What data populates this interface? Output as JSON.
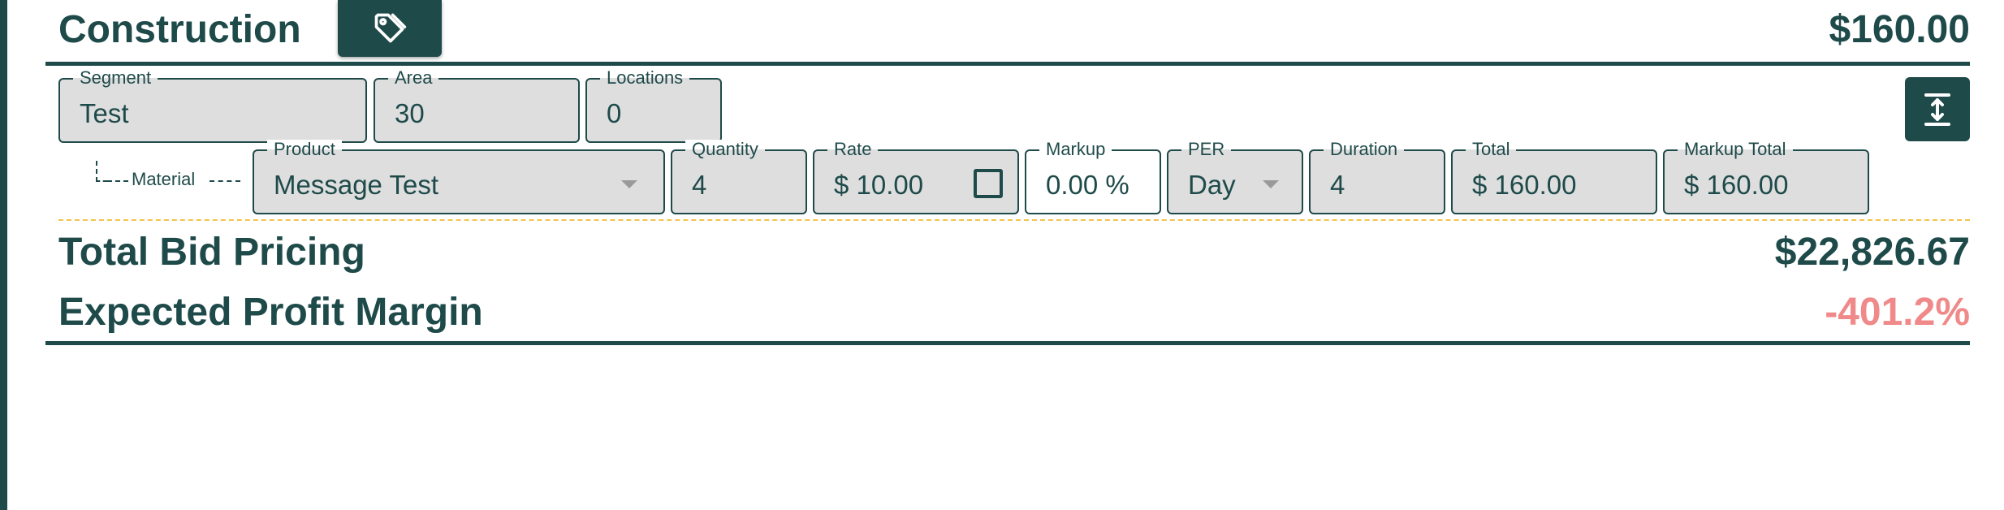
{
  "header": {
    "title": "Construction",
    "total": "$160.00",
    "tag_icon": "tag-icon"
  },
  "segment_fields": [
    {
      "label": "Segment",
      "value": "Test"
    },
    {
      "label": "Area",
      "value": "30"
    },
    {
      "label": "Locations",
      "value": "0"
    }
  ],
  "expand_icon": "expand-vertical-icon",
  "line_item": {
    "type_label": "Material",
    "product": {
      "label": "Product",
      "value": "Message Test"
    },
    "quantity": {
      "label": "Quantity",
      "value": "4"
    },
    "rate": {
      "label": "Rate",
      "value": "$ 10.00",
      "checkbox_checked": false
    },
    "markup": {
      "label": "Markup",
      "value": "0.00 %"
    },
    "per": {
      "label": "PER",
      "value": "Day"
    },
    "duration": {
      "label": "Duration",
      "value": "4"
    },
    "total": {
      "label": "Total",
      "value": "$ 160.00"
    },
    "markup_total": {
      "label": "Markup Total",
      "value": "$ 160.00"
    }
  },
  "summary": {
    "total_bid_label": "Total Bid Pricing",
    "total_bid_value": "$22,826.67",
    "profit_margin_label": "Expected Profit Margin",
    "profit_margin_value": "-401.2%"
  },
  "colors": {
    "primary": "#1f4a4a",
    "field_bg": "#dedede",
    "negative": "#f08a8a",
    "separator": "#f2c44b"
  }
}
